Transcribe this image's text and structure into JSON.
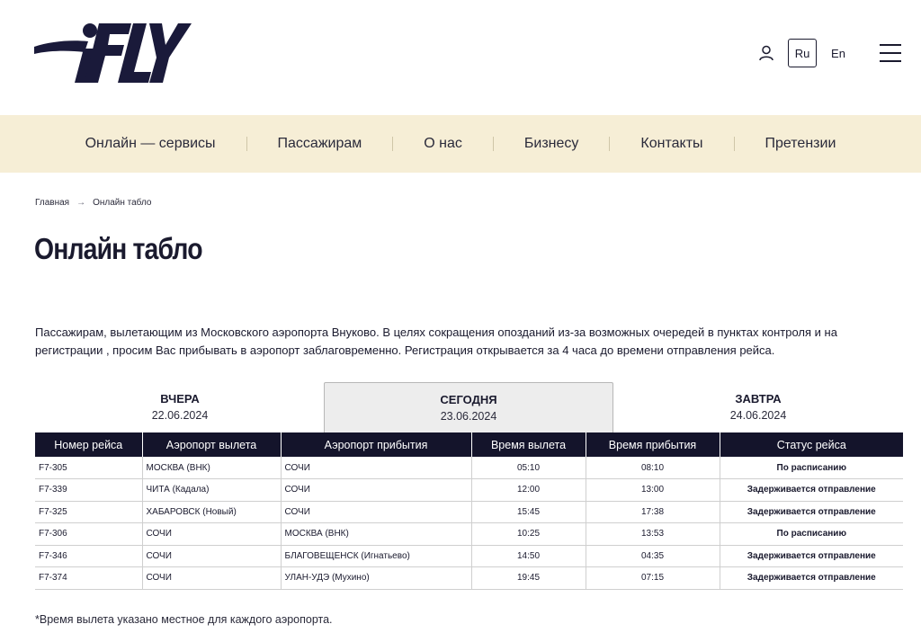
{
  "header": {
    "logo_text": "iFLY",
    "lang_ru": "Ru",
    "lang_en": "En"
  },
  "nav": {
    "items": [
      "Онлайн — сервисы",
      "Пассажирам",
      "О нас",
      "Бизнесу",
      "Контакты",
      "Претензии"
    ]
  },
  "breadcrumb": {
    "home": "Главная",
    "current": "Онлайн табло"
  },
  "page": {
    "title": "Онлайн табло",
    "intro": "Пассажирам, вылетающим из Московского аэропорта Внуково. В целях сокращения опозданий из-за возможных очередей в пунктах контроля и на регистрации , просим Вас прибывать в аэропорт заблаговременно. Регистрация открывается за 4 часа до времени отправления рейса.",
    "footnote": "*Время вылета указано местное для каждого аэропорта."
  },
  "tabs": [
    {
      "label": "ВЧЕРА",
      "date": "22.06.2024",
      "active": false
    },
    {
      "label": "СЕГОДНЯ",
      "date": "23.06.2024",
      "active": true
    },
    {
      "label": "ЗАВТРА",
      "date": "24.06.2024",
      "active": false
    }
  ],
  "table": {
    "headers": [
      "Номер рейса",
      "Аэропорт вылета",
      "Аэропорт прибытия",
      "Время вылета",
      "Время прибытия",
      "Статус рейса"
    ],
    "rows": [
      [
        "F7-305",
        "МОСКВА (ВНК)",
        "СОЧИ",
        "05:10",
        "08:10",
        "По расписанию"
      ],
      [
        "F7-339",
        "ЧИТА (Кадала)",
        "СОЧИ",
        "12:00",
        "13:00",
        "Задерживается отправление"
      ],
      [
        "F7-325",
        "ХАБАРОВСК (Новый)",
        "СОЧИ",
        "15:45",
        "17:38",
        "Задерживается отправление"
      ],
      [
        "F7-306",
        "СОЧИ",
        "МОСКВА (ВНК)",
        "10:25",
        "13:53",
        "По расписанию"
      ],
      [
        "F7-346",
        "СОЧИ",
        "БЛАГОВЕЩЕНСК (Игнатьево)",
        "14:50",
        "04:35",
        "Задерживается отправление"
      ],
      [
        "F7-374",
        "СОЧИ",
        "УЛАН-УДЭ (Мухино)",
        "19:45",
        "07:15",
        "Задерживается отправление"
      ]
    ]
  },
  "colors": {
    "brand_dark": "#14142b",
    "nav_bg": "#f6eed6",
    "active_tab_bg": "#ededed"
  },
  "icons": {
    "user": "user-icon",
    "menu": "menu-icon",
    "arrow": "arrow-right-icon"
  }
}
